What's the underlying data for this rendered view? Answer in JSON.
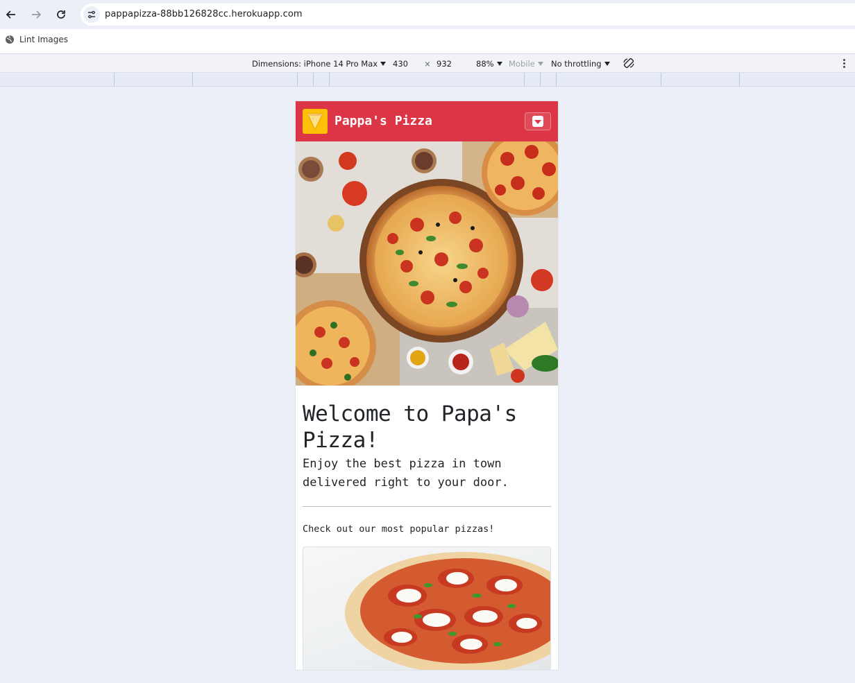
{
  "browser": {
    "url": "pappapizza-88bb126828cc.herokuapp.com",
    "bookmark_label": "Lint Images"
  },
  "device_toolbar": {
    "dimensions_label": "Dimensions: iPhone 14 Pro Max",
    "width": "430",
    "times": "×",
    "height": "932",
    "zoom": "88%",
    "mode": "Mobile",
    "throttling": "No throttling"
  },
  "site": {
    "brand": "Pappa's Pizza",
    "headline": "Welcome to Papa's Pizza!",
    "lead": "Enjoy the best pizza in town delivered right to your door.",
    "popular_text": "Check out our most popular pizzas!"
  },
  "colors": {
    "navbar": "#dc3545",
    "logo_bg": "#ffc107"
  }
}
